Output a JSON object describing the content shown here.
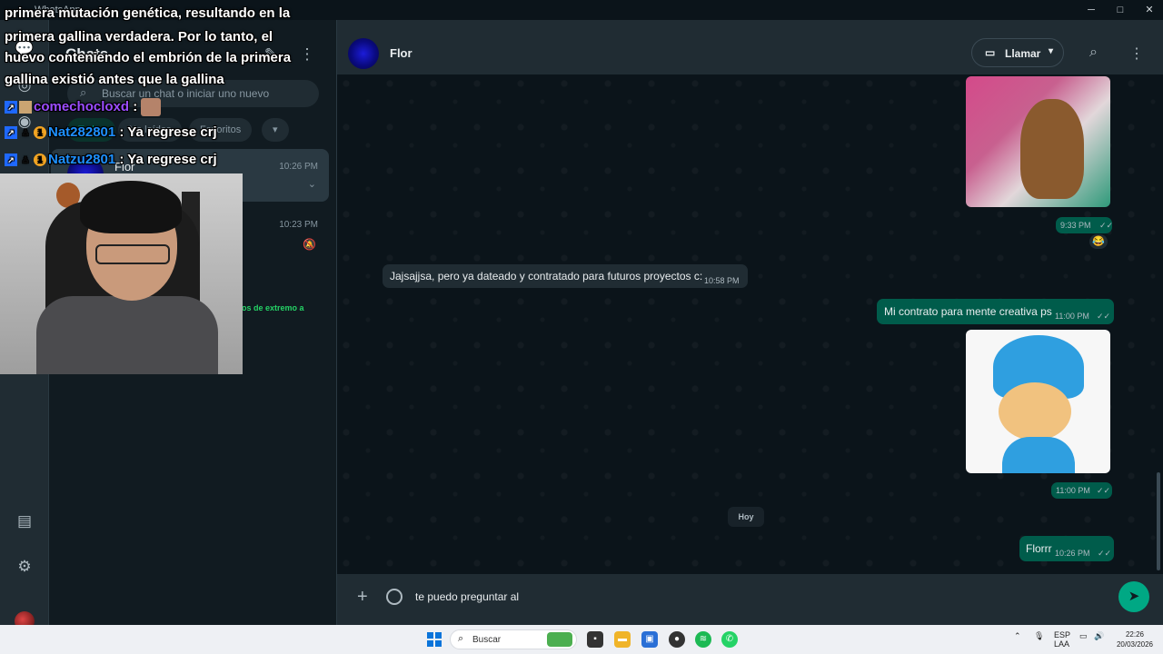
{
  "window": {
    "title": "WhatsApp",
    "minimize": "─",
    "maximize": "□",
    "close": "✕"
  },
  "nav_rail": {
    "icons": [
      "chats-icon",
      "status-icon",
      "channels-icon",
      "media-icon",
      "settings-icon"
    ]
  },
  "chat_list": {
    "heading": "Chats",
    "search_placeholder": "Buscar un chat o iniciar uno nuevo",
    "filters": [
      "Todos",
      "No leídos",
      "Favoritos"
    ],
    "items": [
      {
        "name": "Flor",
        "time": "10:26 PM"
      },
      {
        "name": "",
        "time": "10:23 PM",
        "preview": "os de extremo a"
      }
    ]
  },
  "chat": {
    "contact_name": "Flor",
    "call_label": "Llamar",
    "messages": [
      {
        "type": "image",
        "direction": "out",
        "time": "9:33 PM",
        "reaction": "😂"
      },
      {
        "type": "text",
        "direction": "in",
        "text": "Jajsajjsa, pero ya dateado y contratado para futuros proyectos c:",
        "time": "10:58 PM"
      },
      {
        "type": "text",
        "direction": "out",
        "text": "Mi contrato para mente creativa ps",
        "time": "11:00 PM"
      },
      {
        "type": "image",
        "direction": "out",
        "time": "11:00 PM"
      },
      {
        "type": "text",
        "direction": "out",
        "text": "Florrr",
        "time": "10:26 PM"
      }
    ],
    "date_divider": "Hoy",
    "composer_text": "te puedo preguntar al"
  },
  "stream_overlay": {
    "lines": [
      "primera mutación genética, resultando en la",
      "primera gallina verdadera. Por lo tanto, el",
      "huevo conteniendo el embrión de la primera",
      "gallina existió antes que la gallina"
    ],
    "chat": [
      {
        "user": "comechocloxd",
        "message": ""
      },
      {
        "user": "Nat282801",
        "message": "Ya regrese crj"
      },
      {
        "user": "Natzu2801",
        "message": "Ya regrese crj"
      }
    ]
  },
  "taskbar": {
    "search_label": "Buscar",
    "tray_lang_line1": "ESP",
    "tray_lang_line2": "LAA",
    "time": "22:26",
    "date": "20/03/2026"
  }
}
